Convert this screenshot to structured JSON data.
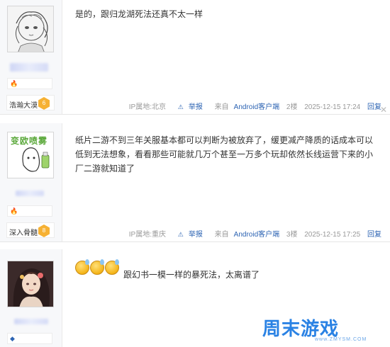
{
  "posts": [
    {
      "level_name": "浩瀚大漠",
      "level_num": "6",
      "content": "是的，跟归龙湖死法还真不太一样",
      "ip_location": "IP属地:北京",
      "report_label": "举报",
      "client_prefix": "来自",
      "client_name": "Android客户端",
      "floor": "2楼",
      "timestamp": "2025-12-15 17:24",
      "reply_label": "回复"
    },
    {
      "level_name": "深入骨髓",
      "level_num": "8",
      "avatar_text": "变欧喷雾",
      "content": "纸片二游不到三年关服基本都可以判断为被放弃了，缓更减产降质的话成本可以低到无法想象，看看那些可能就几万个甚至一万多个玩却依然长线运营下来的小厂二游就知道了",
      "ip_location": "IP属地:重庆",
      "report_label": "举报",
      "client_prefix": "来自",
      "client_name": "Android客户端",
      "floor": "3楼",
      "timestamp": "2025-12-15 17:25",
      "reply_label": "回复"
    },
    {
      "content": "跟幻书一模一样的暴死法，太离谱了"
    }
  ],
  "icons": {
    "report": "warning-triangle-icon",
    "badge": "flame-badge-icon",
    "emoji": "sweat-smile-emoji-icon",
    "close": "close-icon"
  },
  "watermark": {
    "brand": "周末游戏",
    "site": "www.ZMYSM.COM"
  },
  "colors": {
    "link": "#2d64b3",
    "watermark": "#2a82e4",
    "level_badge": "#f6b133"
  }
}
